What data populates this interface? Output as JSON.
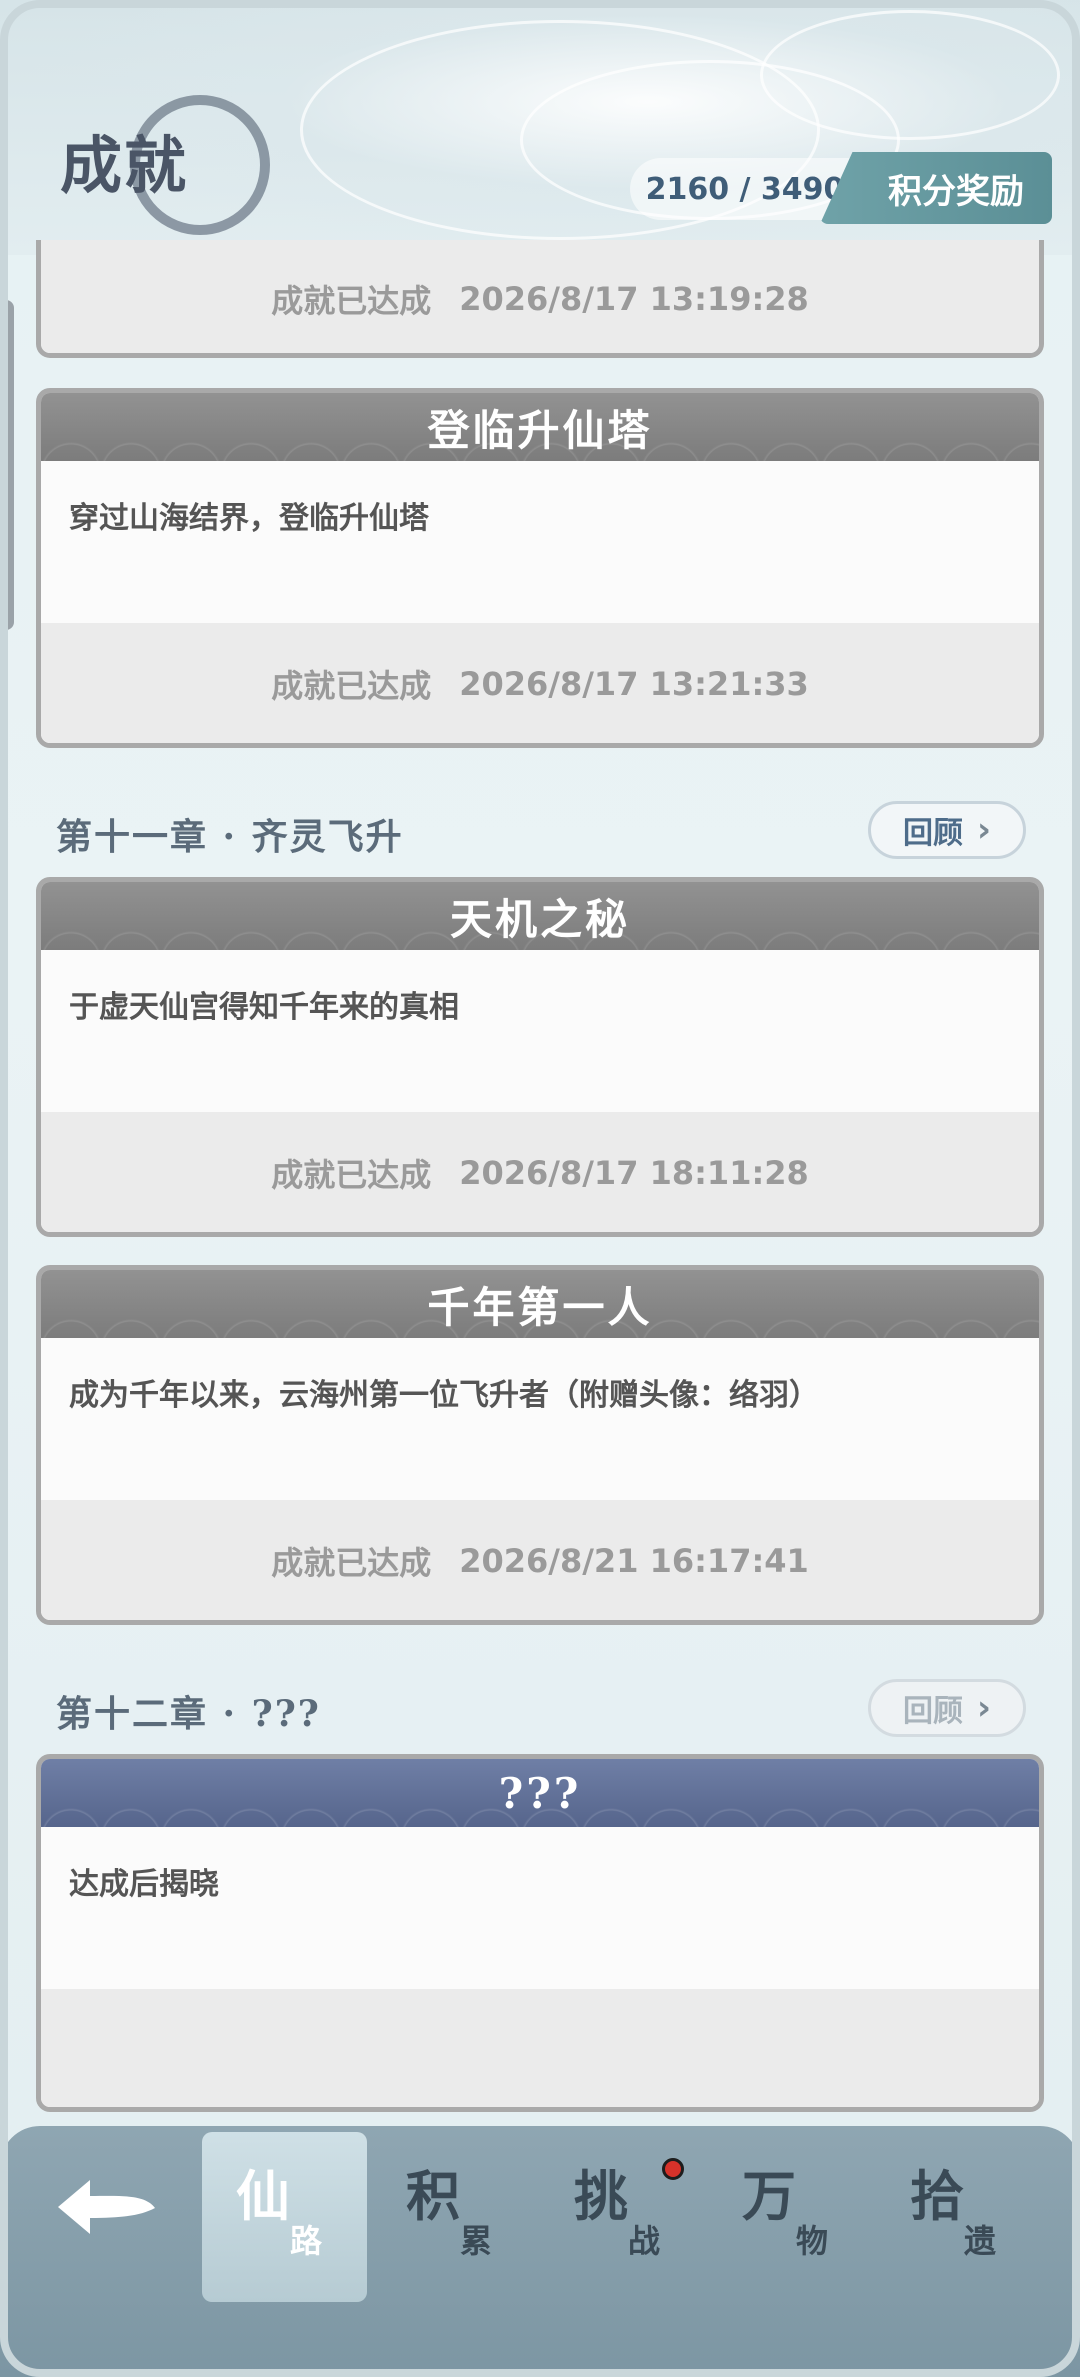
{
  "header": {
    "title": "成就",
    "score": "2160 / 3490",
    "reward_label": "积分奖励"
  },
  "cards": [
    {
      "status": "成就已达成",
      "time": "2026/8/17 13:19:28"
    },
    {
      "title": "登临升仙塔",
      "desc": "穿过山海结界，登临升仙塔",
      "status": "成就已达成",
      "time": "2026/8/17 13:21:33"
    },
    {
      "title": "天机之秘",
      "desc": "于虚天仙宫得知千年来的真相",
      "status": "成就已达成",
      "time": "2026/8/17 18:11:28"
    },
    {
      "title": "千年第一人",
      "desc": "成为千年以来，云海州第一位飞升者（附赠头像：络羽）",
      "status": "成就已达成",
      "time": "2026/8/21 16:17:41"
    },
    {
      "title": "???",
      "desc": "达成后揭晓",
      "status": "",
      "time": ""
    }
  ],
  "chapters": [
    {
      "label": "第十一章 · 齐灵飞升",
      "review": "回顾"
    },
    {
      "label": "第十二章 · ???",
      "review": "回顾"
    }
  ],
  "nav": [
    {
      "big": "仙",
      "small": "路"
    },
    {
      "big": "积",
      "small": "累"
    },
    {
      "big": "挑",
      "small": "战"
    },
    {
      "big": "万",
      "small": "物"
    },
    {
      "big": "拾",
      "small": "遗"
    }
  ],
  "colors": {
    "accent": "#5b8f96",
    "card_header": "#8a8a8a",
    "locked_header": "#5e6d93",
    "notification": "#d6322a"
  },
  "icons": {
    "back": "back-arrow-icon",
    "chevron": "chevron-right-icon"
  }
}
